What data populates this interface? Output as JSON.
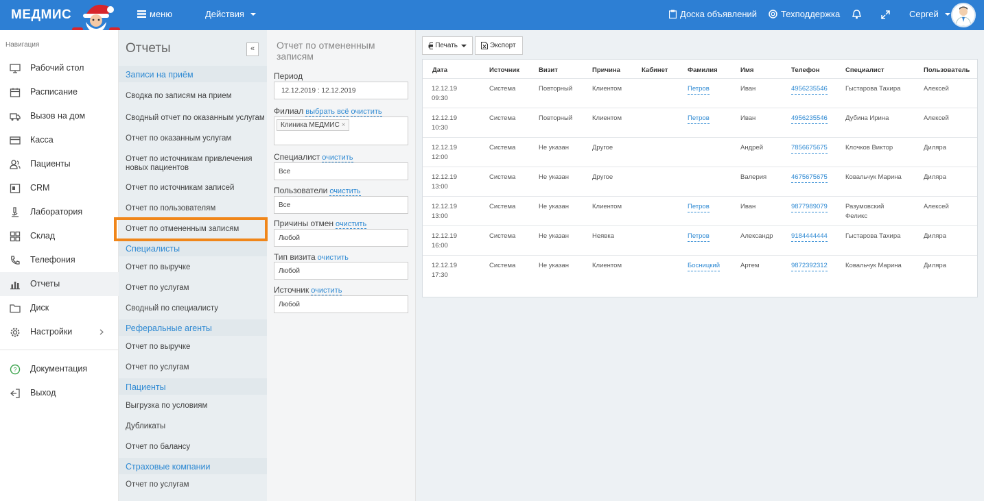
{
  "app": {
    "logo": "МЕДМИС",
    "menu": "меню",
    "actions": "Действия",
    "board": "Доска объявлений",
    "support": "Техподдержка",
    "user": "Сергей"
  },
  "nav": {
    "header": "Навигация",
    "items": [
      {
        "label": "Рабочий стол",
        "icon": "monitor-icon"
      },
      {
        "label": "Расписание",
        "icon": "calendar-icon"
      },
      {
        "label": "Вызов на дом",
        "icon": "truck-icon"
      },
      {
        "label": "Касса",
        "icon": "card-icon"
      },
      {
        "label": "Пациенты",
        "icon": "users-icon"
      },
      {
        "label": "CRM",
        "icon": "crm-icon"
      },
      {
        "label": "Лаборатория",
        "icon": "microscope-icon"
      },
      {
        "label": "Склад",
        "icon": "grid-icon"
      },
      {
        "label": "Телефония",
        "icon": "phone-icon"
      },
      {
        "label": "Отчеты",
        "icon": "bar-chart-icon"
      },
      {
        "label": "Диск",
        "icon": "folder-icon"
      },
      {
        "label": "Настройки",
        "icon": "gear-icon"
      }
    ],
    "bottom": [
      {
        "label": "Документация",
        "icon": "help-icon"
      },
      {
        "label": "Выход",
        "icon": "exit-icon"
      }
    ]
  },
  "reports": {
    "title": "Отчеты",
    "collapse": "«",
    "sections": [
      {
        "title": "Записи на приём",
        "items": [
          "Сводка по записям на прием",
          "Сводный отчет по оказанным услугам",
          "Отчет по оказанным услугам",
          "Отчет по источникам привлечения новых пациентов",
          "Отчет по источникам записей",
          "Отчет по пользователям",
          "Отчет по отмененным записям"
        ]
      },
      {
        "title": "Специалисты",
        "items": [
          "Отчет по выручке",
          "Отчет по услугам",
          "Сводный по специалисту"
        ]
      },
      {
        "title": "Реферальные агенты",
        "items": [
          "Отчет по выручке",
          "Отчет по услугам"
        ]
      },
      {
        "title": "Пациенты",
        "items": [
          "Выгрузка по условиям",
          "Дубликаты",
          "Отчет по балансу"
        ]
      },
      {
        "title": "Страховые компании",
        "items": [
          "Отчет по услугам"
        ]
      }
    ]
  },
  "filters": {
    "title": "Отчет по отмененным записям",
    "period_label": "Период",
    "period_value": "12.12.2019 : 12.12.2019",
    "branch_label": "Филиал",
    "select_all": "выбрать всё",
    "clear": "очистить",
    "branch_tag": "Клиника МЕДМИС",
    "specialist_label": "Специалист",
    "specialist_value": "Все",
    "users_label": "Пользователи",
    "users_value": "Все",
    "reasons_label": "Причины отмен",
    "reasons_value": "Любой",
    "visit_label": "Тип визита",
    "visit_value": "Любой",
    "source_label": "Источник",
    "source_value": "Любой"
  },
  "toolbar": {
    "print": "Печать",
    "export": "Экспорт"
  },
  "table": {
    "headers": [
      "Дата",
      "Источник",
      "Визит",
      "Причина",
      "Кабинет",
      "Фамилия",
      "Имя",
      "Телефон",
      "Специалист",
      "Пользователь"
    ],
    "rows": [
      {
        "date": "12.12.19",
        "time": "09:30",
        "source": "Система",
        "visit": "Повторный",
        "reason": "Клиентом",
        "cabinet": "",
        "surname": "Петров",
        "name": "Иван",
        "phone": "4956235546",
        "spec1": "Гыстарова Тахира",
        "spec2": "",
        "user": "Алексей"
      },
      {
        "date": "12.12.19",
        "time": "10:30",
        "source": "Система",
        "visit": "Повторный",
        "reason": "Клиентом",
        "cabinet": "",
        "surname": "Петров",
        "name": "Иван",
        "phone": "4956235546",
        "spec1": "Дубина Ирина",
        "spec2": "",
        "user": "Алексей"
      },
      {
        "date": "12.12.19",
        "time": "12:00",
        "source": "Система",
        "visit": "Не указан",
        "reason": "Другое",
        "cabinet": "",
        "surname": "",
        "name": "Андрей",
        "phone": "7856675675",
        "spec1": "Клочков Виктор",
        "spec2": "",
        "user": "Диляра"
      },
      {
        "date": "12.12.19",
        "time": "13:00",
        "source": "Система",
        "visit": "Не указан",
        "reason": "Другое",
        "cabinet": "",
        "surname": "",
        "name": "Валерия",
        "phone": "4675675675",
        "spec1": "Ковальчук Марина",
        "spec2": "",
        "user": "Диляра"
      },
      {
        "date": "12.12.19",
        "time": "13:00",
        "source": "Система",
        "visit": "Не указан",
        "reason": "Клиентом",
        "cabinet": "",
        "surname": "Петров",
        "name": "Иван",
        "phone": "9877989079",
        "spec1": "Разумовский",
        "spec2": "Феликс",
        "user": "Алексей"
      },
      {
        "date": "12.12.19",
        "time": "16:00",
        "source": "Система",
        "visit": "Не указан",
        "reason": "Неявка",
        "cabinet": "",
        "surname": "Петров",
        "name": "Александр",
        "phone": "9184444444",
        "spec1": "Гыстарова Тахира",
        "spec2": "",
        "user": "Диляра"
      },
      {
        "date": "12.12.19",
        "time": "17:30",
        "source": "Система",
        "visit": "Не указан",
        "reason": "Клиентом",
        "cabinet": "",
        "surname": "Босницкий",
        "name": "Артем",
        "phone": "9872392312",
        "spec1": "Ковальчук Марина",
        "spec2": "",
        "user": "Диляра"
      }
    ]
  }
}
